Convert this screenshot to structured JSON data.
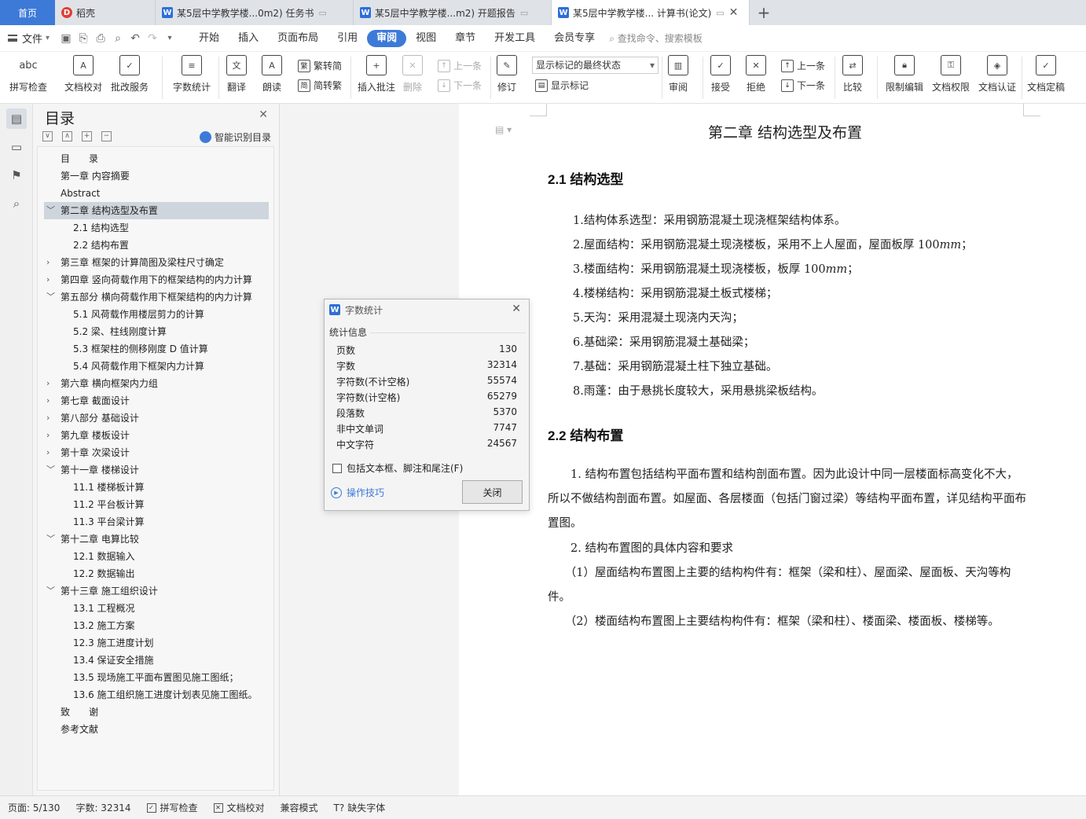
{
  "tabs": {
    "home": "首页",
    "items": [
      {
        "label": "稻壳",
        "icon": "daoke-icon"
      },
      {
        "label": "某5层中学教学楼...0m2) 任务书",
        "icon": "wps-writer-icon"
      },
      {
        "label": "某5层中学教学楼...m2) 开题报告",
        "icon": "wps-writer-icon"
      },
      {
        "label": "某5层中学教学楼... 计算书(论文)",
        "icon": "wps-writer-icon"
      }
    ],
    "add": "+"
  },
  "menubar": {
    "file": "文件",
    "items": [
      "开始",
      "插入",
      "页面布局",
      "引用",
      "审阅",
      "视图",
      "章节",
      "开发工具",
      "会员专享"
    ],
    "active": "审阅",
    "search": "查找命令、搜索模板"
  },
  "ribbon": {
    "spellcheck": "拼写检查",
    "doc_proof": "文档校对",
    "approve": "批改服务",
    "word_count": "字数统计",
    "translate": "翻译",
    "read_aloud": "朗读",
    "to_traditional": "繁转简",
    "to_simplified": "简转繁",
    "insert_comment": "插入批注",
    "delete": "删除",
    "prev_comment": "上一条",
    "next_comment": "下一条",
    "track_changes": "修订",
    "markup_mode": "显示标记的最终状态",
    "show_markup": "显示标记",
    "review": "审阅",
    "accept": "接受",
    "reject": "拒绝",
    "prev_change": "上一条",
    "next_change": "下一条",
    "compare": "比较",
    "restrict_edit": "限制编辑",
    "doc_permission": "文档权限",
    "doc_cert": "文档认证",
    "doc_finalize": "文档定稿"
  },
  "toc": {
    "title": "目录",
    "smart": "智能识别目录",
    "items": [
      {
        "label": "目　　录",
        "level": 0,
        "arrow": ""
      },
      {
        "label": "第一章  内容摘要",
        "level": 0,
        "arrow": ""
      },
      {
        "label": "Abstract",
        "level": 0,
        "arrow": ""
      },
      {
        "label": "第二章  结构选型及布置",
        "level": 0,
        "arrow": "﹀",
        "selected": true
      },
      {
        "label": "2.1 结构选型",
        "level": 1,
        "arrow": ""
      },
      {
        "label": "2.2 结构布置",
        "level": 1,
        "arrow": ""
      },
      {
        "label": "第三章  框架的计算简图及梁柱尺寸确定",
        "level": 0,
        "arrow": "›"
      },
      {
        "label": "第四章  竖向荷载作用下的框架结构的内力计算",
        "level": 0,
        "arrow": "›"
      },
      {
        "label": "第五部分  横向荷载作用下框架结构的内力计算",
        "level": 0,
        "arrow": "﹀"
      },
      {
        "label": "5.1 风荷载作用楼层剪力的计算",
        "level": 1,
        "arrow": ""
      },
      {
        "label": "5.2 梁、柱线刚度计算",
        "level": 1,
        "arrow": ""
      },
      {
        "label": "5.3 框架柱的侧移刚度 D 值计算",
        "level": 1,
        "arrow": ""
      },
      {
        "label": "5.4 风荷载作用下框架内力计算",
        "level": 1,
        "arrow": ""
      },
      {
        "label": "第六章  横向框架内力组",
        "level": 0,
        "arrow": "›"
      },
      {
        "label": "第七章  截面设计",
        "level": 0,
        "arrow": "›"
      },
      {
        "label": "第八部分  基础设计",
        "level": 0,
        "arrow": "›"
      },
      {
        "label": "第九章  楼板设计",
        "level": 0,
        "arrow": "›"
      },
      {
        "label": "第十章  次梁设计",
        "level": 0,
        "arrow": "›"
      },
      {
        "label": "第十一章  楼梯设计",
        "level": 0,
        "arrow": "﹀"
      },
      {
        "label": "11.1 楼梯板计算",
        "level": 1,
        "arrow": ""
      },
      {
        "label": "11.2 平台板计算",
        "level": 1,
        "arrow": ""
      },
      {
        "label": "11.3 平台梁计算",
        "level": 1,
        "arrow": ""
      },
      {
        "label": "第十二章  电算比较",
        "level": 0,
        "arrow": "﹀"
      },
      {
        "label": "12.1 数据输入",
        "level": 1,
        "arrow": ""
      },
      {
        "label": "12.2 数据输出",
        "level": 1,
        "arrow": ""
      },
      {
        "label": "第十三章  施工组织设计",
        "level": 0,
        "arrow": "﹀"
      },
      {
        "label": "13.1  工程概况",
        "level": 1,
        "arrow": ""
      },
      {
        "label": "13.2  施工方案",
        "level": 1,
        "arrow": ""
      },
      {
        "label": "12.3  施工进度计划",
        "level": 1,
        "arrow": ""
      },
      {
        "label": "13.4  保证安全措施",
        "level": 1,
        "arrow": ""
      },
      {
        "label": "13.5 现场施工平面布置图见施工图纸；",
        "level": 1,
        "arrow": ""
      },
      {
        "label": "13.6 施工组织施工进度计划表见施工图纸。",
        "level": 1,
        "arrow": ""
      },
      {
        "label": "致　　谢",
        "level": 0,
        "arrow": ""
      },
      {
        "label": "参考文献",
        "level": 0,
        "arrow": ""
      }
    ]
  },
  "dialog": {
    "title": "字数统计",
    "section": "统计信息",
    "rows": [
      {
        "label": "页数",
        "value": "130"
      },
      {
        "label": "字数",
        "value": "32314"
      },
      {
        "label": "字符数(不计空格)",
        "value": "55574"
      },
      {
        "label": "字符数(计空格)",
        "value": "65279"
      },
      {
        "label": "段落数",
        "value": "5370"
      },
      {
        "label": "非中文单词",
        "value": "7747"
      },
      {
        "label": "中文字符",
        "value": "24567"
      }
    ],
    "checkbox": "包括文本框、脚注和尾注(F)",
    "tips": "操作技巧",
    "close": "关闭"
  },
  "document": {
    "chapter": "第二章  结构选型及布置",
    "h21": "2.1 结构选型",
    "list": [
      "1.结构体系选型：采用钢筋混凝土现浇框架结构体系。",
      "2.屋面结构：采用钢筋混凝土现浇楼板，采用不上人屋面，屋面板厚 100𝑚𝑚；",
      "3.楼面结构：采用钢筋混凝土现浇楼板，板厚 100𝑚𝑚；",
      "4.楼梯结构：采用钢筋混凝土板式楼梯；",
      "5.天沟：采用混凝土现浇内天沟；",
      "6.基础梁：采用钢筋混凝土基础梁；",
      "7.基础：采用钢筋混凝土柱下独立基础。",
      "8.雨蓬：由于悬挑长度较大，采用悬挑梁板结构。"
    ],
    "h22": "2.2 结构布置",
    "p1": "　　1. 结构布置包括结构平面布置和结构剖面布置。因为此设计中同一层楼面标高变化不大，所以不做结构剖面布置。如屋面、各层楼面（包括门窗过梁）等结构平面布置，详见结构平面布置图。",
    "p2": "　　2. 结构布置图的具体内容和要求",
    "p3": "　　（1）屋面结构布置图上主要的结构构件有：框架（梁和柱）、屋面梁、屋面板、天沟等构件。",
    "p4": "　　（2）楼面结构布置图上主要结构构件有：框架（梁和柱）、楼面梁、楼面板、楼梯等。"
  },
  "statusbar": {
    "page": "页面: 5/130",
    "words": "字数: 32314",
    "spell": "拼写检查",
    "proof": "文档校对",
    "compat": "兼容模式",
    "missing_font": "缺失字体"
  }
}
